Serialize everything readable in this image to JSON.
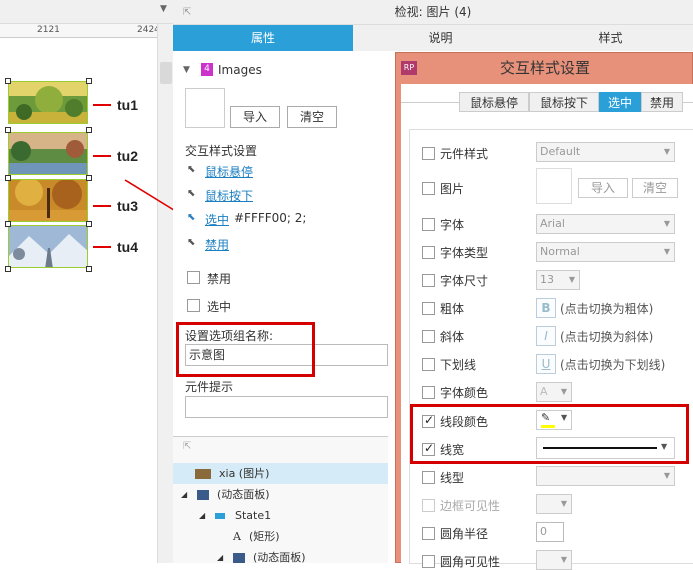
{
  "canvas": {
    "ruler_ticks": [
      "2121",
      "2424"
    ],
    "images": [
      {
        "label": "tu1",
        "colors": [
          "#7aa33a",
          "#d6c23a",
          "#4c6f2a"
        ]
      },
      {
        "label": "tu2",
        "colors": [
          "#c3a070",
          "#5d8c42",
          "#6f96b9"
        ]
      },
      {
        "label": "tu3",
        "colors": [
          "#c98a2a",
          "#8a5a1e",
          "#e0b040"
        ]
      },
      {
        "label": "tu4",
        "colors": [
          "#9eb8d6",
          "#e8eef5",
          "#6c7a8c"
        ]
      }
    ]
  },
  "inspector": {
    "title": "检视: 图片 (4)",
    "tabs": [
      "属性",
      "说明",
      "样式"
    ],
    "page_number": "4",
    "images_label": "Images",
    "import_button": "导入",
    "clear_button": "清空",
    "interaction_title": "交互样式设置",
    "interactions": [
      {
        "label": "鼠标悬停",
        "suffix": ""
      },
      {
        "label": "鼠标按下",
        "suffix": ""
      },
      {
        "label": "选中",
        "suffix": "#FFFF00; 2;"
      },
      {
        "label": "禁用",
        "suffix": ""
      }
    ],
    "disabled_checkbox": "禁用",
    "selected_checkbox": "选中",
    "group_name_label": "设置选项组名称:",
    "group_name_value": "示意图",
    "tooltip_label": "元件提示"
  },
  "outline": {
    "rows": [
      "xia (图片)",
      "(动态面板)",
      "State1",
      "(矩形)",
      "(动态面板)"
    ]
  },
  "dialog": {
    "logo": "RP",
    "title": "交互样式设置",
    "tabs": [
      "鼠标悬停",
      "鼠标按下",
      "选中",
      "禁用"
    ],
    "active_tab": "选中",
    "rows": {
      "component_style": {
        "label": "元件样式",
        "value": "Default"
      },
      "image": {
        "label": "图片",
        "import": "导入",
        "clear": "清空"
      },
      "font": {
        "label": "字体",
        "value": "Arial"
      },
      "font_type": {
        "label": "字体类型",
        "value": "Normal"
      },
      "font_size": {
        "label": "字体尺寸",
        "value": "13"
      },
      "bold": {
        "label": "粗体",
        "button": "B",
        "hint": "(点击切换为粗体)"
      },
      "italic": {
        "label": "斜体",
        "button": "I",
        "hint": "(点击切换为斜体)"
      },
      "underline": {
        "label": "下划线",
        "button": "U",
        "hint": "(点击切换为下划线)"
      },
      "font_color": {
        "label": "字体颜色"
      },
      "line_color": {
        "label": "线段颜色",
        "color": "#FFFF00"
      },
      "line_width": {
        "label": "线宽"
      },
      "line_type": {
        "label": "线型"
      },
      "border_visibility": {
        "label": "边框可见性"
      },
      "corner_radius": {
        "label": "圆角半径",
        "value": "0"
      },
      "corner_visibility": {
        "label": "圆角可见性"
      }
    }
  }
}
